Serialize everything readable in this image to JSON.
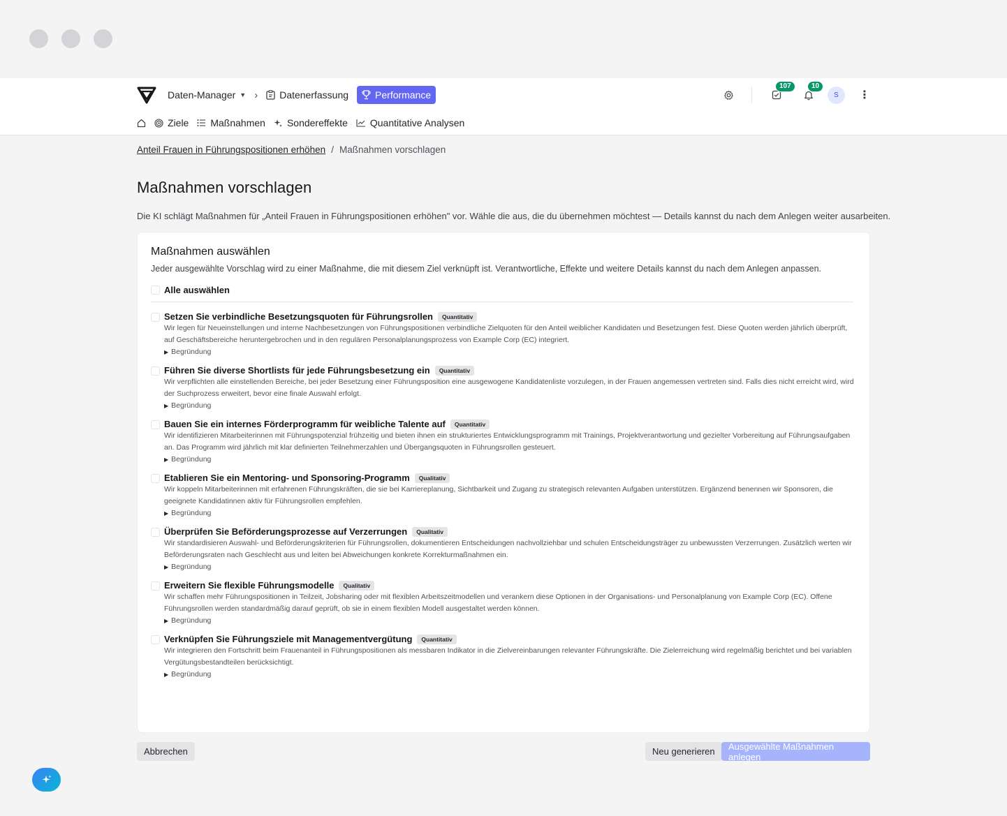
{
  "nav": {
    "data_manager": "Daten-Manager",
    "datenerfassung": "Datenerfassung",
    "performance": "Performance",
    "tasks_count": "107",
    "notifications_count": "10",
    "avatar_initial": "S",
    "secondary": [
      "Ziele",
      "Maßnahmen",
      "Sondereffekte",
      "Quantitative Analysen"
    ]
  },
  "breadcrumb": {
    "parent": "Anteil Frauen in Führungspositionen erhöhen",
    "current": "Maßnahmen vorschlagen"
  },
  "page": {
    "title": "Maßnahmen vorschlagen",
    "intro": "Die KI schlägt Maßnahmen für „Anteil Frauen in Führungspositionen erhöhen\" vor. Wähle die aus, die du übernehmen möchtest — Details kannst du nach dem Anlegen weiter ausarbeiten."
  },
  "card": {
    "title": "Maßnahmen auswählen",
    "subtitle": "Jeder ausgewählte Vorschlag wird zu einer Maßnahme, die mit diesem Ziel verknüpft ist. Verantwortliche, Effekte und weitere Details kannst du nach dem Anlegen anpassen.",
    "select_all": "Alle auswählen",
    "reason_label": "Begründung",
    "measures": [
      {
        "title": "Setzen Sie verbindliche Besetzungsquoten für Führungsrollen",
        "tag": "Quantitativ",
        "desc": "Wir legen für Neueinstellungen und interne Nachbesetzungen von Führungspositionen verbindliche Zielquoten für den Anteil weiblicher Kandidaten und Besetzungen fest. Diese Quoten werden jährlich überprüft, auf Geschäftsbereiche heruntergebrochen und in den regulären Personalplanungsprozess von Example Corp (EC) integriert."
      },
      {
        "title": "Führen Sie diverse Shortlists für jede Führungsbesetzung ein",
        "tag": "Quantitativ",
        "desc": "Wir verpflichten alle einstellenden Bereiche, bei jeder Besetzung einer Führungsposition eine ausgewogene Kandidatenliste vorzulegen, in der Frauen angemessen vertreten sind. Falls dies nicht erreicht wird, wird der Suchprozess erweitert, bevor eine finale Auswahl erfolgt."
      },
      {
        "title": "Bauen Sie ein internes Förderprogramm für weibliche Talente auf",
        "tag": "Quantitativ",
        "desc": "Wir identifizieren Mitarbeiterinnen mit Führungspotenzial frühzeitig und bieten ihnen ein strukturiertes Entwicklungsprogramm mit Trainings, Projektverantwortung und gezielter Vorbereitung auf Führungsaufgaben an. Das Programm wird jährlich mit klar definierten Teilnehmerzahlen und Übergangsquoten in Führungsrollen gesteuert."
      },
      {
        "title": "Etablieren Sie ein Mentoring- und Sponsoring-Programm",
        "tag": "Qualitativ",
        "desc": "Wir koppeln Mitarbeiterinnen mit erfahrenen Führungskräften, die sie bei Karriereplanung, Sichtbarkeit und Zugang zu strategisch relevanten Aufgaben unterstützen. Ergänzend benennen wir Sponsoren, die geeignete Kandidatinnen aktiv für Führungsrollen empfehlen."
      },
      {
        "title": "Überprüfen Sie Beförderungsprozesse auf Verzerrungen",
        "tag": "Qualitativ",
        "desc": "Wir standardisieren Auswahl- und Beförderungskriterien für Führungsrollen, dokumentieren Entscheidungen nachvollziehbar und schulen Entscheidungsträger zu unbewussten Verzerrungen. Zusätzlich werten wir Beförderungsraten nach Geschlecht aus und leiten bei Abweichungen konkrete Korrekturmaßnahmen ein."
      },
      {
        "title": "Erweitern Sie flexible Führungsmodelle",
        "tag": "Qualitativ",
        "desc": "Wir schaffen mehr Führungspositionen in Teilzeit, Jobsharing oder mit flexiblen Arbeitszeitmodellen und verankern diese Optionen in der Organisations- und Personalplanung von Example Corp (EC). Offene Führungsrollen werden standardmäßig darauf geprüft, ob sie in einem flexiblen Modell ausgestaltet werden können."
      },
      {
        "title": "Verknüpfen Sie Führungsziele mit Managementvergütung",
        "tag": "Quantitativ",
        "desc": "Wir integrieren den Fortschritt beim Frauenanteil in Führungspositionen als messbaren Indikator in die Zielvereinbarungen relevanter Führungskräfte. Die Zielerreichung wird regelmäßig berichtet und bei variablen Vergütungsbestandteilen berücksichtigt."
      }
    ]
  },
  "actions": {
    "cancel": "Abbrechen",
    "regenerate": "Neu generieren",
    "create": "Ausgewählte Maßnahmen anlegen"
  },
  "colors": {
    "accent": "#6366f1",
    "accent_disabled": "#a5b4fc",
    "badge": "#059669"
  }
}
